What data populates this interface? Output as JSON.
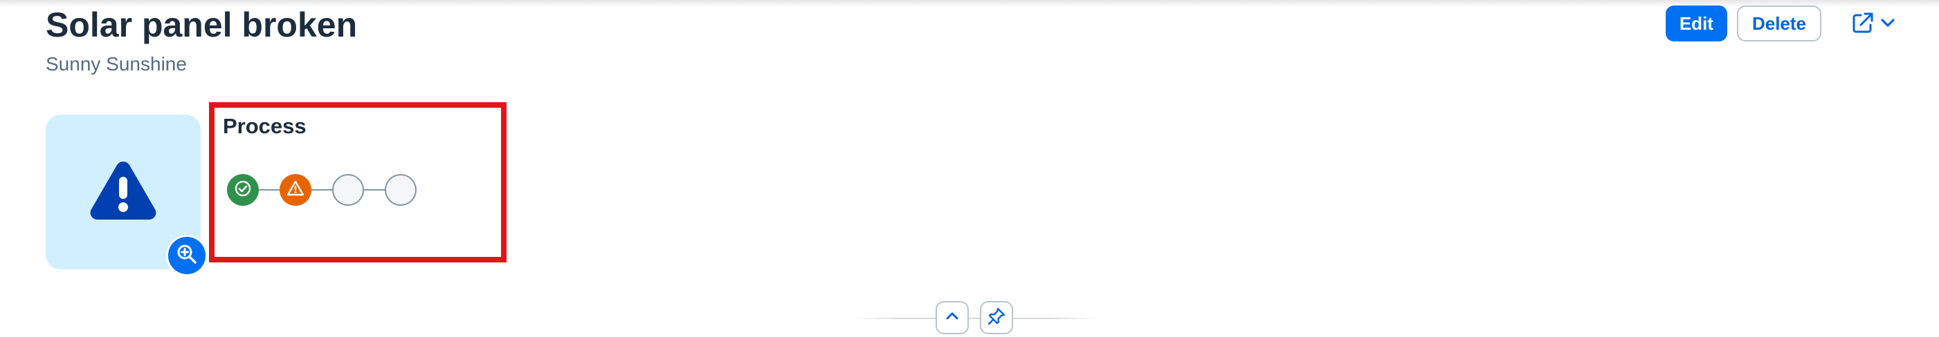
{
  "header": {
    "title": "Solar panel broken",
    "subtitle": "Sunny Sunshine"
  },
  "actions": {
    "edit_label": "Edit",
    "delete_label": "Delete",
    "share_icon": "share-icon",
    "menu_icon": "chevron-down-icon"
  },
  "avatar": {
    "icon": "alert-triangle-icon",
    "zoom_icon": "zoom-in-icon"
  },
  "process": {
    "title": "Process",
    "steps": [
      {
        "status": "positive",
        "icon": "check-circle-icon"
      },
      {
        "status": "critical",
        "icon": "warning-icon"
      },
      {
        "status": "neutral",
        "icon": ""
      },
      {
        "status": "neutral",
        "icon": ""
      }
    ]
  },
  "footer": {
    "collapse_icon": "chevron-up-icon",
    "pin_icon": "pin-icon"
  },
  "colors": {
    "brand": "#0070f2",
    "positive": "#30914c",
    "critical": "#e76500",
    "highlight_frame": "#e0161b",
    "avatar_bg": "#d1efff",
    "avatar_icon": "#0040b0"
  }
}
